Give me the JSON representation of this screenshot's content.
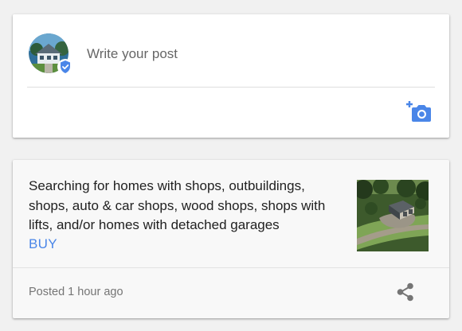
{
  "composer": {
    "placeholder": "Write your post",
    "avatar_icon": "house-photo",
    "badge_icon": "verified-shield-icon",
    "action_icon": "add-photo-icon"
  },
  "post": {
    "text": "Searching for homes with shops, outbuildings, shops, auto & car shops, wood shops, shops with lifts, and/or homes with detached garages",
    "cta_label": "BUY",
    "posted": "Posted 1 hour ago",
    "image_icon": "shop-building-aerial-photo",
    "share_icon": "share-icon"
  },
  "colors": {
    "accent": "#4a86e8",
    "page_background": "#f1f1f1"
  }
}
